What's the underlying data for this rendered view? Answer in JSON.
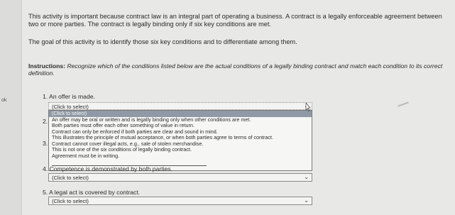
{
  "intro": {
    "text": "This activity is important because contract law is an integral part of operating a business. A contract is a legally enforceable agreement between two or more parties. The contract is legally binding only if six key conditions are met."
  },
  "goal": {
    "text": "The goal of this activity is to identify those six key conditions and to differentiate among them."
  },
  "instructions": {
    "label": "Instructions",
    "text": "Recognize which of the conditions listed below are the actual conditions of a legally binding contract and match each condition to its correct definition."
  },
  "gutter": {
    "label": "ok"
  },
  "questions": [
    {
      "number": "1.",
      "text": "An offer is made.",
      "select_value": "(Click to select)"
    },
    {
      "number": "2."
    },
    {
      "number": "3."
    },
    {
      "number": "4.",
      "text": "Competence is demonstrated by both parties.",
      "select_value": "(Click to select)"
    },
    {
      "number": "5.",
      "text": "A legal act is covered by contract.",
      "select_value": "(Click to select)"
    }
  ],
  "dropdown": {
    "options": [
      "(Click to select)",
      "An offer may be oral or written and is legally binding only when other conditions are met.",
      "Both parties must offer each other something of value in return.",
      "Contract can only be enforced if both parties are clear and sound in mind.",
      "This illustrates the principle of mutual acceptance, or when both parties agree to terms of contract.",
      "Contract cannot cover illegal acts, e.g., sale of stolen merchandise.",
      "This is not one of the six conditions of legally binding contract.",
      "Agreement must be in writing."
    ]
  },
  "colors": {
    "highlight": "#8f9aa6",
    "background": "#e8e8e6"
  }
}
